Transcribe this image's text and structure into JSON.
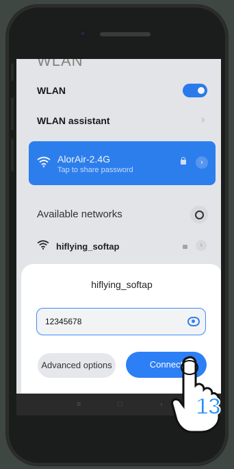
{
  "screen": {
    "header_peek": "WLAN",
    "wlan_label": "WLAN",
    "wlan_enabled": true,
    "assistant_label": "WLAN assistant",
    "connected": {
      "name": "AlorAir-2.4G",
      "subtitle": "Tap to share password"
    },
    "available_title": "Available networks",
    "networks": [
      {
        "name": "hiflying_softap",
        "locked": true
      }
    ]
  },
  "dialog": {
    "title": "hiflying_softap",
    "password_value": "12345678",
    "advanced_label": "Advanced options",
    "connect_label": "Connect"
  },
  "annotation": {
    "step": "13"
  },
  "colors": {
    "accent": "#2d7ff5",
    "screen_bg": "#edeef1",
    "phone_body": "#1b1c1c",
    "page_bg": "#3f4743"
  }
}
